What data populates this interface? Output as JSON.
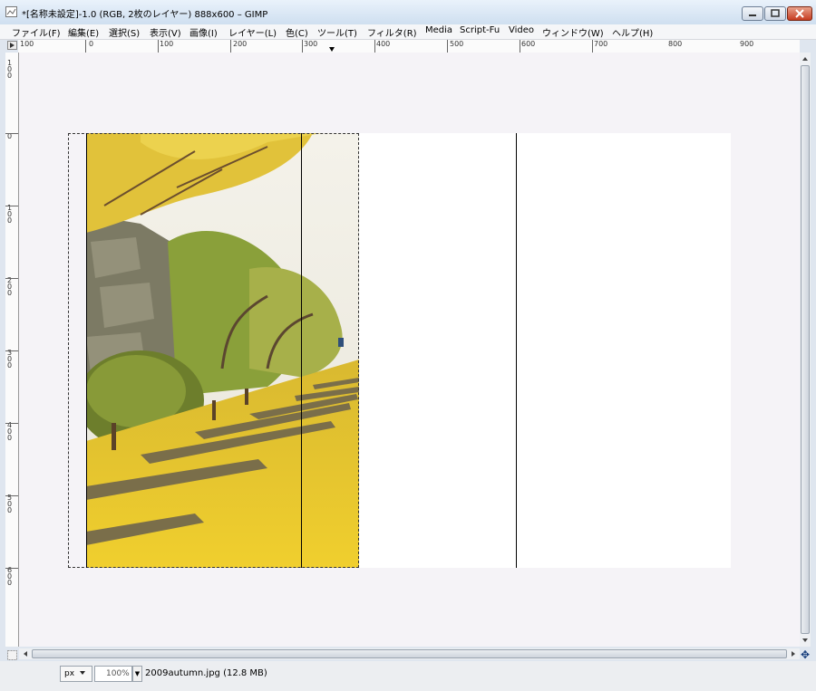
{
  "window": {
    "title": "*[名称未設定]-1.0 (RGB, 2枚のレイヤー) 888x600 – GIMP"
  },
  "menu": {
    "items": [
      "ファイル(F)",
      "編集(E)",
      "選択(S)",
      "表示(V)",
      "画像(I)",
      "レイヤー(L)",
      "色(C)",
      "ツール(T)",
      "フィルタ(R)",
      "Media",
      "Script-Fu",
      "Video",
      "ウィンドウ(W)",
      "ヘルプ(H)"
    ]
  },
  "ruler": {
    "horizontal": [
      "100",
      "0",
      "100",
      "200",
      "300",
      "400",
      "500",
      "600",
      "700",
      "800",
      "900"
    ],
    "vertical": [
      "100",
      "0",
      "100",
      "200",
      "300",
      "400",
      "500",
      "600"
    ]
  },
  "statusbar": {
    "unit": "px",
    "zoom": "100%",
    "message": "2009autumn.jpg (12.8 MB)"
  },
  "colors": {
    "canvas_bg": "#f5f3f7",
    "layer_white": "#ffffff",
    "ginkgo_yellow": "#e8c42a"
  }
}
